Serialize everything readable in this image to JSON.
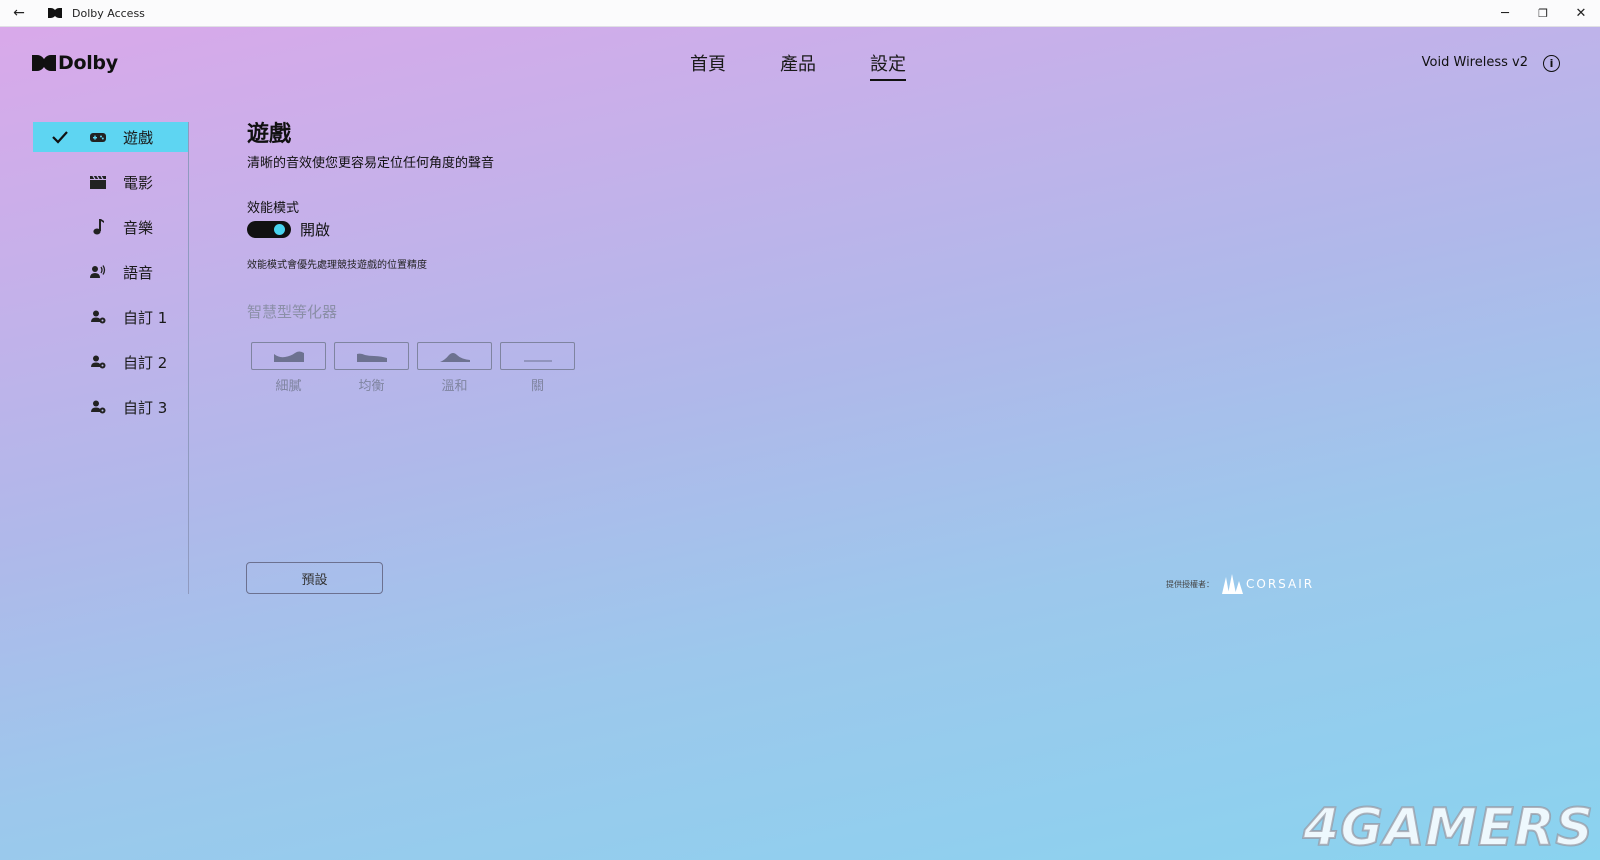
{
  "titlebar": {
    "back_icon": "arrow-left-icon",
    "app_title": "Dolby Access",
    "minimize": "─",
    "restore": "❐",
    "close": "✕"
  },
  "header": {
    "brand": "Dolby",
    "nav": [
      {
        "label": "首頁",
        "active": false
      },
      {
        "label": "產品",
        "active": false
      },
      {
        "label": "設定",
        "active": true
      }
    ],
    "device": "Void Wireless v2",
    "info_icon": "i"
  },
  "sidebar": {
    "items": [
      {
        "label": "遊戲",
        "icon": "gamepad-icon",
        "active": true
      },
      {
        "label": "電影",
        "icon": "clapperboard-icon",
        "active": false
      },
      {
        "label": "音樂",
        "icon": "music-note-icon",
        "active": false
      },
      {
        "label": "語音",
        "icon": "voice-icon",
        "active": false
      },
      {
        "label": "自訂 1",
        "icon": "user-settings-icon",
        "active": false
      },
      {
        "label": "自訂 2",
        "icon": "user-settings-icon",
        "active": false
      },
      {
        "label": "自訂 3",
        "icon": "user-settings-icon",
        "active": false
      }
    ]
  },
  "main": {
    "title": "遊戲",
    "subtitle": "清晰的音效使您更容易定位任何角度的聲音",
    "performance": {
      "label": "效能模式",
      "state": "開啟",
      "enabled": true,
      "description": "效能模式會優先處理競技遊戲的位置精度"
    },
    "equalizer": {
      "title": "智慧型等化器",
      "options": [
        {
          "label": "細膩",
          "icon": "eq-detailed-icon"
        },
        {
          "label": "均衡",
          "icon": "eq-balanced-icon"
        },
        {
          "label": "溫和",
          "icon": "eq-warm-icon"
        },
        {
          "label": "關",
          "icon": "eq-off-icon"
        }
      ]
    },
    "preset_button": "預設"
  },
  "footer": {
    "powered_by": "提供授權者：",
    "partner": "CORSAIR"
  },
  "watermark": "4GAMERS",
  "colors": {
    "accent": "#5ed5f2",
    "toggle_knob": "#49d3ee",
    "toggle_track": "#111111",
    "muted": "#7f84a0"
  }
}
